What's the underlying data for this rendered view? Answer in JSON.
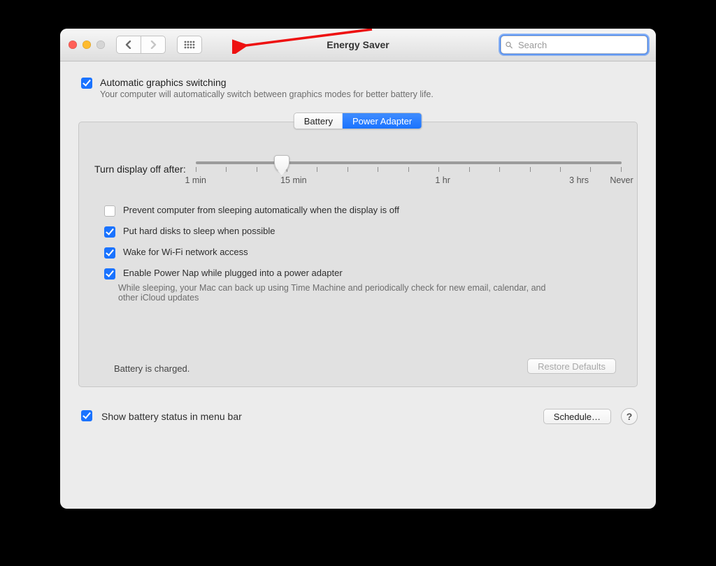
{
  "window": {
    "title": "Energy Saver",
    "search_placeholder": "Search",
    "traffic_colors": {
      "close": "#ff5f57",
      "min": "#febb2e",
      "zoom_disabled": "#d5d5d5"
    }
  },
  "auto_graphics": {
    "checked": true,
    "label": "Automatic graphics switching",
    "description": "Your computer will automatically switch between graphics modes for better battery life."
  },
  "tabs": {
    "items": [
      "Battery",
      "Power Adapter"
    ],
    "active_index": 1
  },
  "slider": {
    "label": "Turn display off after:",
    "ticks": [
      "1 min",
      "15 min",
      "1 hr",
      "3 hrs",
      "Never"
    ]
  },
  "options": [
    {
      "checked": false,
      "label": "Prevent computer from sleeping automatically when the display is off",
      "sub": null
    },
    {
      "checked": true,
      "label": "Put hard disks to sleep when possible",
      "sub": null
    },
    {
      "checked": true,
      "label": "Wake for Wi-Fi network access",
      "sub": null
    },
    {
      "checked": true,
      "label": "Enable Power Nap while plugged into a power adapter",
      "sub": "While sleeping, your Mac can back up using Time Machine and periodically check for new email, calendar, and other iCloud updates"
    }
  ],
  "battery_status": "Battery is charged.",
  "buttons": {
    "restore_defaults": "Restore Defaults",
    "schedule": "Schedule…"
  },
  "footer": {
    "show_battery_status": {
      "checked": true,
      "label": "Show battery status in menu bar"
    },
    "help": "?"
  }
}
